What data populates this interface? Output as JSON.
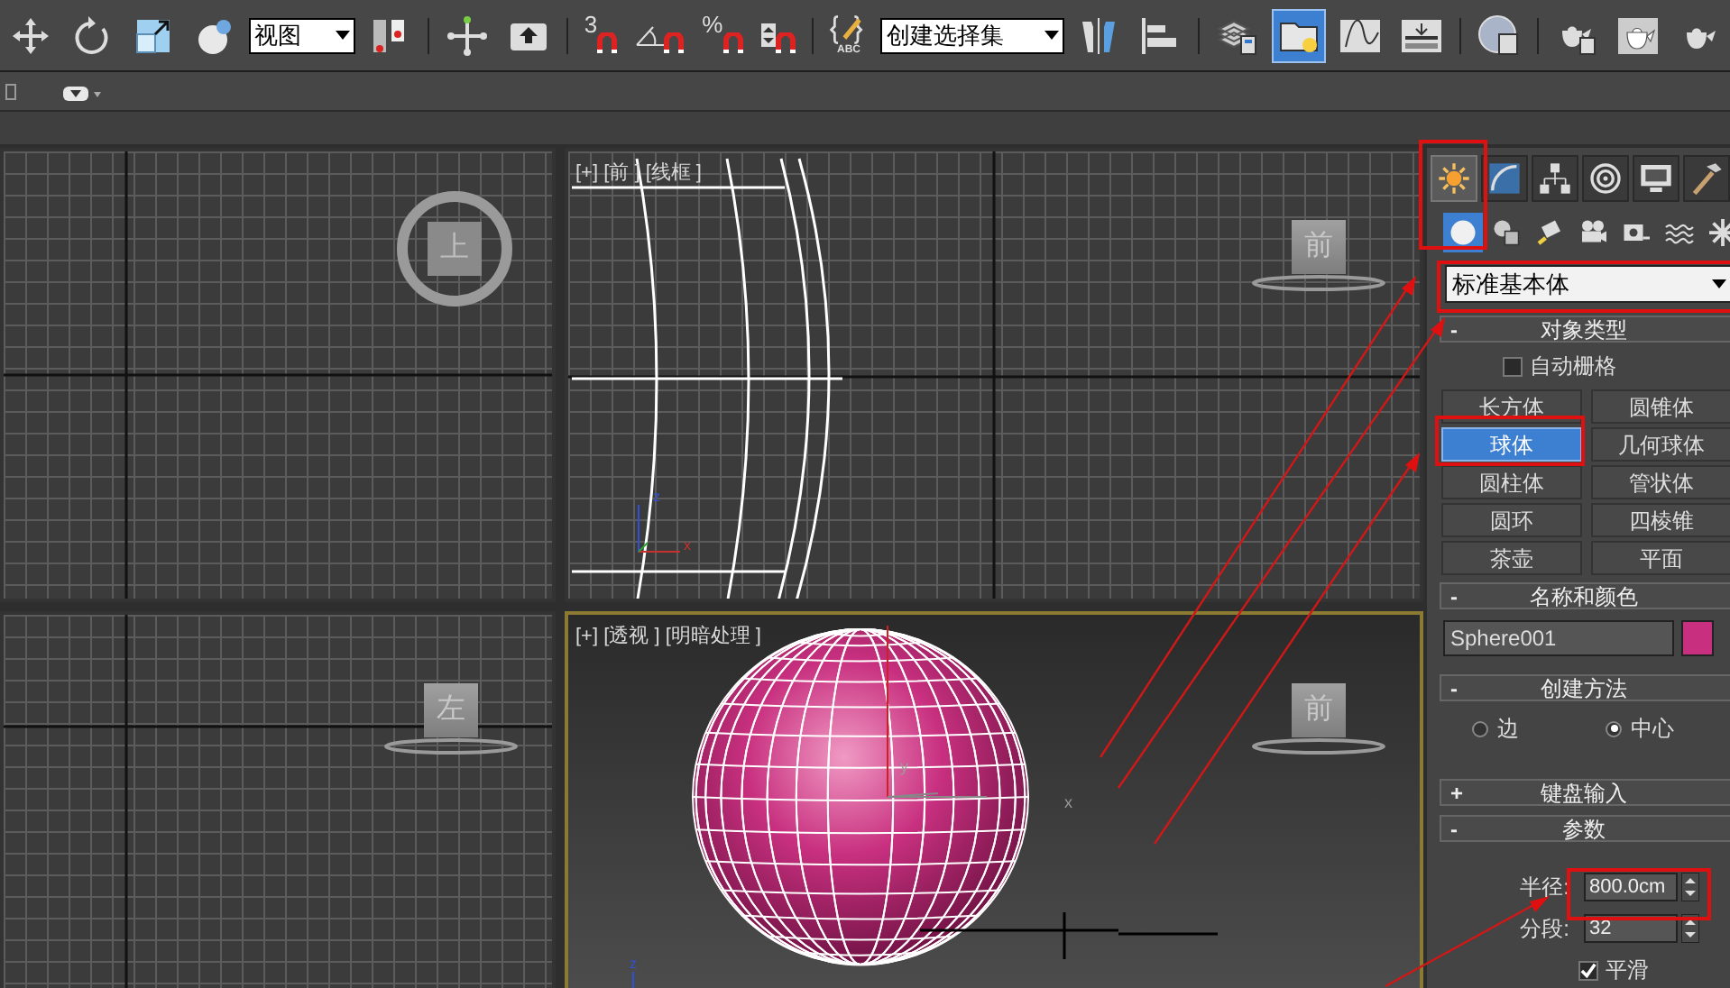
{
  "toolbar": {
    "groups": [
      [
        {
          "kind": "button",
          "selected": false
        },
        {
          "kind": "button",
          "selected": false
        },
        {
          "kind": "button",
          "selected": false
        },
        {
          "kind": "button",
          "selected": false
        },
        {
          "kind": "dropdown",
          "value": "视图"
        },
        {
          "kind": "button",
          "selected": false
        }
      ],
      [
        {
          "kind": "button",
          "selected": false
        },
        {
          "kind": "button",
          "selected": false
        }
      ],
      [
        {
          "kind": "snap",
          "label": "3",
          "selected": false
        },
        {
          "kind": "snap",
          "selected": false
        },
        {
          "kind": "snap",
          "label": "%",
          "selected": false
        },
        {
          "kind": "snap",
          "selected": false
        }
      ],
      [
        {
          "kind": "button",
          "label": "ABC",
          "selected": false
        },
        {
          "kind": "dropdown",
          "value": "创建选择集"
        },
        {
          "kind": "button",
          "selected": false
        },
        {
          "kind": "button",
          "selected": false
        }
      ],
      [
        {
          "kind": "button",
          "selected": false
        },
        {
          "kind": "button",
          "selected": true
        },
        {
          "kind": "button",
          "selected": false
        },
        {
          "kind": "button",
          "selected": false
        }
      ],
      [
        {
          "kind": "button",
          "selected": false
        }
      ],
      [
        {
          "kind": "button",
          "selected": false
        },
        {
          "kind": "button",
          "selected": false
        },
        {
          "kind": "button",
          "selected": false
        }
      ]
    ]
  },
  "viewports": {
    "left": [
      {
        "kind": "top",
        "viewcube": "上",
        "active": false
      },
      {
        "kind": "left",
        "viewcube": "左",
        "active": false
      }
    ],
    "center": [
      {
        "kind": "front",
        "label": "[+] [前 ] [线框 ]",
        "viewcube": "前",
        "axis_labels": [
          "z",
          "x"
        ],
        "active": false
      },
      {
        "kind": "perspective",
        "label": "[+] [透视 ] [明暗处理 ]",
        "viewcube": "前",
        "axis_labels": [
          "z"
        ],
        "pivot_labels": [
          "y",
          "x"
        ],
        "active": true
      }
    ]
  },
  "command_panel": {
    "tabs": [
      {
        "selected": true
      },
      {
        "selected": false
      },
      {
        "selected": false
      },
      {
        "selected": false
      },
      {
        "selected": false
      },
      {
        "selected": false
      }
    ],
    "categories": [
      {
        "selected": true
      },
      {
        "selected": false
      },
      {
        "selected": false
      },
      {
        "selected": false
      },
      {
        "selected": false
      },
      {
        "selected": false
      },
      {
        "selected": false
      }
    ],
    "dropdown": "标准基本体",
    "rollouts": [
      {
        "kind": "object_type",
        "toggle": "-",
        "title": "对象类型",
        "checkbox": {
          "label": "自动栅格",
          "checked": false
        },
        "buttons": [
          {
            "label": "长方体",
            "selected": false
          },
          {
            "label": "圆锥体",
            "selected": false
          },
          {
            "label": "球体",
            "selected": true
          },
          {
            "label": "几何球体",
            "selected": false
          },
          {
            "label": "圆柱体",
            "selected": false
          },
          {
            "label": "管状体",
            "selected": false
          },
          {
            "label": "圆环",
            "selected": false
          },
          {
            "label": "四棱锥",
            "selected": false
          },
          {
            "label": "茶壶",
            "selected": false
          },
          {
            "label": "平面",
            "selected": false
          }
        ]
      },
      {
        "kind": "name_color",
        "toggle": "-",
        "title": "名称和颜色",
        "name": "Sphere001",
        "color": "#c8307f"
      },
      {
        "kind": "creation_method",
        "toggle": "-",
        "title": "创建方法",
        "options": [
          {
            "label": "边",
            "selected": false
          },
          {
            "label": "中心",
            "selected": true
          }
        ]
      },
      {
        "kind": "keyboard_entry",
        "toggle": "+",
        "title": "键盘输入"
      },
      {
        "kind": "parameters",
        "toggle": "-",
        "title": "参数",
        "fields": [
          {
            "label": "半径:",
            "value": "800.0cm"
          },
          {
            "label": "分段:",
            "value": "32"
          }
        ],
        "checkbox": {
          "label": "平滑",
          "checked": true
        }
      }
    ]
  }
}
